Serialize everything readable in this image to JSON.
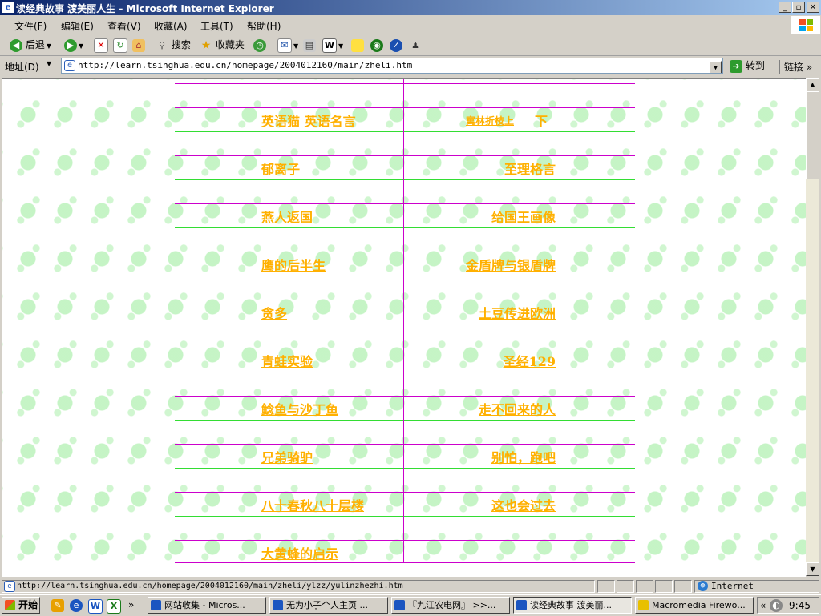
{
  "window": {
    "title": "读经典故事 渡美丽人生 - Microsoft Internet Explorer",
    "app_icon": "ie-icon",
    "min": "_",
    "max": "▫",
    "close": "✕"
  },
  "menu": [
    "文件(F)",
    "编辑(E)",
    "查看(V)",
    "收藏(A)",
    "工具(T)",
    "帮助(H)"
  ],
  "toolbar": {
    "back": "后退",
    "search": "搜索",
    "favorites": "收藏夹"
  },
  "address": {
    "label": "地址(D)",
    "url": "http://learn.tsinghua.edu.cn/homepage/2004012160/main/zheli.htm",
    "go": "转到",
    "links": "链接"
  },
  "stories": {
    "left": [
      "英语猫 英语名言",
      "郁离子",
      "燕人返国",
      "鹰的后半生",
      "贪多",
      "青蛙实验",
      "鲶鱼与沙丁鱼",
      "兄弟骑驴",
      "八十春秋八十层楼",
      "大黄蜂的启示"
    ],
    "right_first": "寓林折枝上",
    "right_first_b": "下",
    "right": [
      "至理格言",
      "给国王画像",
      "金盾牌与银盾牌",
      "土豆传进欧洲",
      "圣经129",
      "走不回来的人",
      "别怕，跑吧",
      "这也会过去"
    ]
  },
  "status": {
    "url": "http://learn.tsinghua.edu.cn/homepage/2004012160/main/zheli/ylzz/yulinzhezhi.htm",
    "zone": "Internet"
  },
  "taskbar": {
    "start": "开始",
    "tasks": [
      "网站收集 - Micros...",
      "无为小子个人主页 ...",
      "『九江农电网』 >>...",
      "读经典故事 渡美丽...",
      "Macromedia Firewo..."
    ],
    "clock": "9:45"
  },
  "colors": {
    "link": "#ffb000",
    "line_green": "#33dd33",
    "line_magenta": "#cc00cc"
  }
}
